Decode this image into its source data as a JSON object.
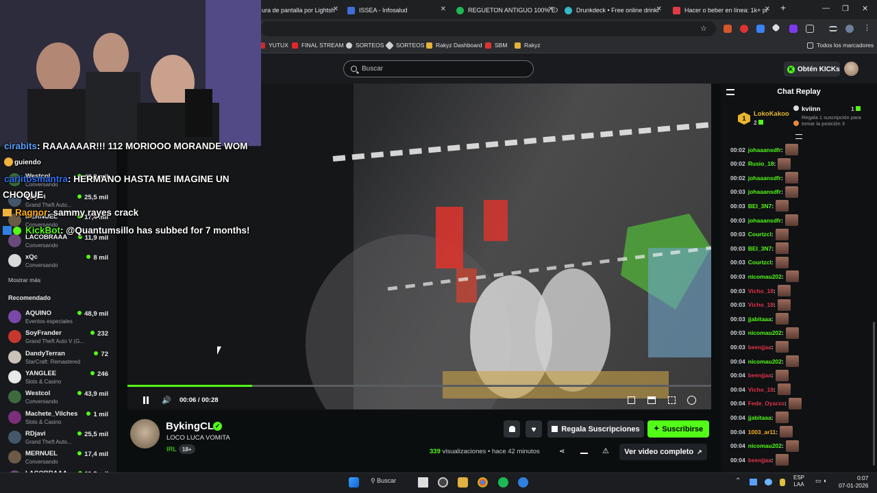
{
  "browser": {
    "tabs": [
      {
        "title": "ura de pantalla por Lightsh",
        "color": "#7a5ef2"
      },
      {
        "title": "ISSEA - Infosalud",
        "color": "#3f6fd6"
      },
      {
        "title": "REGUETON ANTIGUO 100% ÉX",
        "color": "#1db954"
      },
      {
        "title": "Drunkdeck • Free online drinki",
        "color": "#36b7c5"
      },
      {
        "title": "Hacer o beber en línea: 1k+ pr",
        "color": "#e23b44"
      }
    ],
    "bookmarks": [
      {
        "label": "YUTUX",
        "color": "#cc2a2a"
      },
      {
        "label": "FINAL STREAM",
        "color": "#e02828"
      },
      {
        "label": "SORTEOS",
        "color": "#cfcfcf"
      },
      {
        "label": "SORTEOS",
        "color": "#cfcfcf"
      },
      {
        "label": "Rakyz Dashboard",
        "color": "#e2b23b"
      },
      {
        "label": "SBM",
        "color": "#d33"
      },
      {
        "label": "Rakyz",
        "color": "#e2b23b"
      }
    ],
    "all_bookmarks": "Todos los marcadores"
  },
  "header": {
    "search_placeholder": "Buscar",
    "kicks_label": "Obtén KICKs"
  },
  "sidebar": {
    "following": [
      {
        "name": "Westcol",
        "category": "Conversando",
        "viewers": "43,9 mil",
        "color": "#3d6b3d"
      },
      {
        "name": "RDjavi",
        "category": "Grand Theft Auto...",
        "viewers": "25,5 mil",
        "color": "#44586b"
      },
      {
        "name": "MERNUEL",
        "category": "Conversando",
        "viewers": "17,4 mil",
        "color": "#6b5a46"
      },
      {
        "name": "LACOBRAAA",
        "category": "Conversando",
        "viewers": "11,9 mil",
        "color": "#6a4a7a"
      },
      {
        "name": "xQc",
        "category": "Conversando",
        "viewers": "8 mil",
        "color": "#d9d9d9"
      }
    ],
    "show_more": "Mostrar más",
    "recommended_title": "Recomendado",
    "recommended": [
      {
        "name": "AQUINO",
        "category": "Eventos especiales",
        "viewers": "48,9 mil",
        "color": "#7a48a8"
      },
      {
        "name": "SoyFrander",
        "category": "Grand Theft Auto V (G...",
        "viewers": "232",
        "color": "#c8372d"
      },
      {
        "name": "DandyTerran",
        "category": "StarCraft: Remastered",
        "viewers": "72",
        "color": "#c9c2b8"
      },
      {
        "name": "YANGLEE",
        "category": "Slots & Casino",
        "viewers": "246",
        "color": "#e8e8e8"
      },
      {
        "name": "Westcol",
        "category": "Conversando",
        "viewers": "43,9 mil",
        "color": "#3d6b3d"
      },
      {
        "name": "Machete_Vilches",
        "category": "Slots & Casino",
        "viewers": "1 mil",
        "color": "#7a2f7a"
      },
      {
        "name": "RDjavi",
        "category": "Grand Theft Auto...",
        "viewers": "25,5 mil",
        "color": "#44586b"
      },
      {
        "name": "MERNUEL",
        "category": "Conversando",
        "viewers": "17,4 mil",
        "color": "#6b5a46"
      },
      {
        "name": "LACOBRAAA",
        "category": "",
        "viewers": "11,9 mil",
        "color": "#6a4a7a"
      }
    ]
  },
  "overlay_chat": [
    {
      "user": "cirabits",
      "text": ": RAAAAAAR!!! 112 MORIOOO MORANDE WOM",
      "user_color": "#5aa0ff"
    },
    {
      "user": "",
      "text": "guiendo",
      "user_color": "#ffcc33"
    },
    {
      "user": "carlitosmantra",
      "text": ": HERMANO HASTA ME IMAGINE UN",
      "user_color": "#2f6ef0"
    },
    {
      "user": "",
      "text": "CHOQUE",
      "user_color": "#ffffff"
    },
    {
      "user": "Ragnor",
      "text": ": sammy rayes crack",
      "user_color": "#ffb020"
    },
    {
      "user": "KickBot",
      "text": ": @Quantumsillo has subbed for 7 months!",
      "user_color": "#53fc18"
    }
  ],
  "player": {
    "time": "00:06 / 00:28",
    "progress_fraction": 0.214
  },
  "channel": {
    "name": "BykingCL",
    "title": "LOCO LUCA VOMITA",
    "category": "IRL",
    "age": "18+",
    "gift_label": "Regala Suscripciones",
    "subscribe_label": "Suscribirse",
    "views_count": "339",
    "views_label": "visualizaciones",
    "ago": "• hace 42 minutos",
    "full_video": "Ver video completo"
  },
  "chat": {
    "title": "Chat Replay",
    "pinned": [
      {
        "rank": "1",
        "name": "LokoKakoo",
        "count": "2"
      },
      {
        "rank": "",
        "name": "kviinn",
        "count": "1"
      }
    ],
    "gift_note": "Regala 1 suscripción para tomar la posición 3",
    "messages": [
      {
        "time": "00:02",
        "user": "johaaansdfr",
        "color": "#53fc18"
      },
      {
        "time": "00:02",
        "user": "Rusio_18",
        "color": "#53fc18"
      },
      {
        "time": "00:02",
        "user": "johaaansdfr",
        "color": "#53fc18"
      },
      {
        "time": "00:03",
        "user": "johaaansdfr",
        "color": "#53fc18"
      },
      {
        "time": "00:03",
        "user": "BEI_3N7",
        "color": "#53fc18"
      },
      {
        "time": "00:03",
        "user": "johaaansdfr",
        "color": "#53fc18"
      },
      {
        "time": "00:03",
        "user": "Courtzcl",
        "color": "#53fc18"
      },
      {
        "time": "00:03",
        "user": "BEI_3N7",
        "color": "#53fc18"
      },
      {
        "time": "00:03",
        "user": "Courtzcl",
        "color": "#53fc18"
      },
      {
        "time": "00:03",
        "user": "nicomau202",
        "color": "#53fc18"
      },
      {
        "time": "00:03",
        "user": "Vicho_18",
        "color": "#e0334a"
      },
      {
        "time": "00:03",
        "user": "Vicho_18",
        "color": "#e0334a"
      },
      {
        "time": "00:03",
        "user": "jjabitaaa",
        "color": "#53fc18"
      },
      {
        "time": "00:03",
        "user": "nicomau202",
        "color": "#53fc18"
      },
      {
        "time": "00:03",
        "user": "beenjjaa",
        "color": "#e0334a"
      },
      {
        "time": "00:04",
        "user": "nicomau202",
        "color": "#53fc18"
      },
      {
        "time": "00:04",
        "user": "beenjjaa",
        "color": "#e0334a"
      },
      {
        "time": "00:04",
        "user": "Vicho_18",
        "color": "#e0334a"
      },
      {
        "time": "00:04",
        "user": "Fede_Oyarzo",
        "color": "#e0334a"
      },
      {
        "time": "00:04",
        "user": "jjabitaaa",
        "color": "#53fc18"
      },
      {
        "time": "00:04",
        "user": "1003_ar11",
        "color": "#ffb020"
      },
      {
        "time": "00:04",
        "user": "nicomau202",
        "color": "#53fc18"
      },
      {
        "time": "00:04",
        "user": "beenjjaa",
        "color": "#e0334a"
      }
    ]
  },
  "taskbar": {
    "search_label": "Buscar",
    "lang": "ESP",
    "lang2": "LAA",
    "time": "0:07",
    "date": "07-01-2026"
  },
  "colors": {
    "accent": "#53fc18"
  }
}
